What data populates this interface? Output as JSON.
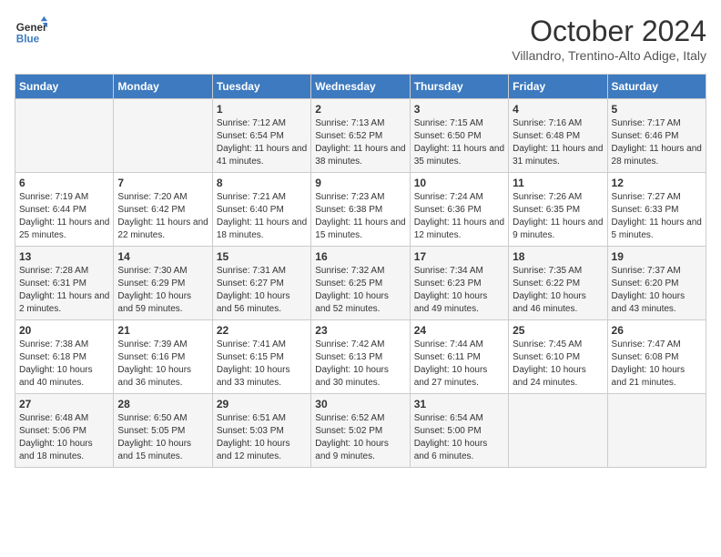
{
  "header": {
    "logo_line1": "General",
    "logo_line2": "Blue",
    "month": "October 2024",
    "location": "Villandro, Trentino-Alto Adige, Italy"
  },
  "days_of_week": [
    "Sunday",
    "Monday",
    "Tuesday",
    "Wednesday",
    "Thursday",
    "Friday",
    "Saturday"
  ],
  "weeks": [
    [
      {
        "day": "",
        "info": ""
      },
      {
        "day": "",
        "info": ""
      },
      {
        "day": "1",
        "info": "Sunrise: 7:12 AM\nSunset: 6:54 PM\nDaylight: 11 hours and 41 minutes."
      },
      {
        "day": "2",
        "info": "Sunrise: 7:13 AM\nSunset: 6:52 PM\nDaylight: 11 hours and 38 minutes."
      },
      {
        "day": "3",
        "info": "Sunrise: 7:15 AM\nSunset: 6:50 PM\nDaylight: 11 hours and 35 minutes."
      },
      {
        "day": "4",
        "info": "Sunrise: 7:16 AM\nSunset: 6:48 PM\nDaylight: 11 hours and 31 minutes."
      },
      {
        "day": "5",
        "info": "Sunrise: 7:17 AM\nSunset: 6:46 PM\nDaylight: 11 hours and 28 minutes."
      }
    ],
    [
      {
        "day": "6",
        "info": "Sunrise: 7:19 AM\nSunset: 6:44 PM\nDaylight: 11 hours and 25 minutes."
      },
      {
        "day": "7",
        "info": "Sunrise: 7:20 AM\nSunset: 6:42 PM\nDaylight: 11 hours and 22 minutes."
      },
      {
        "day": "8",
        "info": "Sunrise: 7:21 AM\nSunset: 6:40 PM\nDaylight: 11 hours and 18 minutes."
      },
      {
        "day": "9",
        "info": "Sunrise: 7:23 AM\nSunset: 6:38 PM\nDaylight: 11 hours and 15 minutes."
      },
      {
        "day": "10",
        "info": "Sunrise: 7:24 AM\nSunset: 6:36 PM\nDaylight: 11 hours and 12 minutes."
      },
      {
        "day": "11",
        "info": "Sunrise: 7:26 AM\nSunset: 6:35 PM\nDaylight: 11 hours and 9 minutes."
      },
      {
        "day": "12",
        "info": "Sunrise: 7:27 AM\nSunset: 6:33 PM\nDaylight: 11 hours and 5 minutes."
      }
    ],
    [
      {
        "day": "13",
        "info": "Sunrise: 7:28 AM\nSunset: 6:31 PM\nDaylight: 11 hours and 2 minutes."
      },
      {
        "day": "14",
        "info": "Sunrise: 7:30 AM\nSunset: 6:29 PM\nDaylight: 10 hours and 59 minutes."
      },
      {
        "day": "15",
        "info": "Sunrise: 7:31 AM\nSunset: 6:27 PM\nDaylight: 10 hours and 56 minutes."
      },
      {
        "day": "16",
        "info": "Sunrise: 7:32 AM\nSunset: 6:25 PM\nDaylight: 10 hours and 52 minutes."
      },
      {
        "day": "17",
        "info": "Sunrise: 7:34 AM\nSunset: 6:23 PM\nDaylight: 10 hours and 49 minutes."
      },
      {
        "day": "18",
        "info": "Sunrise: 7:35 AM\nSunset: 6:22 PM\nDaylight: 10 hours and 46 minutes."
      },
      {
        "day": "19",
        "info": "Sunrise: 7:37 AM\nSunset: 6:20 PM\nDaylight: 10 hours and 43 minutes."
      }
    ],
    [
      {
        "day": "20",
        "info": "Sunrise: 7:38 AM\nSunset: 6:18 PM\nDaylight: 10 hours and 40 minutes."
      },
      {
        "day": "21",
        "info": "Sunrise: 7:39 AM\nSunset: 6:16 PM\nDaylight: 10 hours and 36 minutes."
      },
      {
        "day": "22",
        "info": "Sunrise: 7:41 AM\nSunset: 6:15 PM\nDaylight: 10 hours and 33 minutes."
      },
      {
        "day": "23",
        "info": "Sunrise: 7:42 AM\nSunset: 6:13 PM\nDaylight: 10 hours and 30 minutes."
      },
      {
        "day": "24",
        "info": "Sunrise: 7:44 AM\nSunset: 6:11 PM\nDaylight: 10 hours and 27 minutes."
      },
      {
        "day": "25",
        "info": "Sunrise: 7:45 AM\nSunset: 6:10 PM\nDaylight: 10 hours and 24 minutes."
      },
      {
        "day": "26",
        "info": "Sunrise: 7:47 AM\nSunset: 6:08 PM\nDaylight: 10 hours and 21 minutes."
      }
    ],
    [
      {
        "day": "27",
        "info": "Sunrise: 6:48 AM\nSunset: 5:06 PM\nDaylight: 10 hours and 18 minutes."
      },
      {
        "day": "28",
        "info": "Sunrise: 6:50 AM\nSunset: 5:05 PM\nDaylight: 10 hours and 15 minutes."
      },
      {
        "day": "29",
        "info": "Sunrise: 6:51 AM\nSunset: 5:03 PM\nDaylight: 10 hours and 12 minutes."
      },
      {
        "day": "30",
        "info": "Sunrise: 6:52 AM\nSunset: 5:02 PM\nDaylight: 10 hours and 9 minutes."
      },
      {
        "day": "31",
        "info": "Sunrise: 6:54 AM\nSunset: 5:00 PM\nDaylight: 10 hours and 6 minutes."
      },
      {
        "day": "",
        "info": ""
      },
      {
        "day": "",
        "info": ""
      }
    ]
  ]
}
